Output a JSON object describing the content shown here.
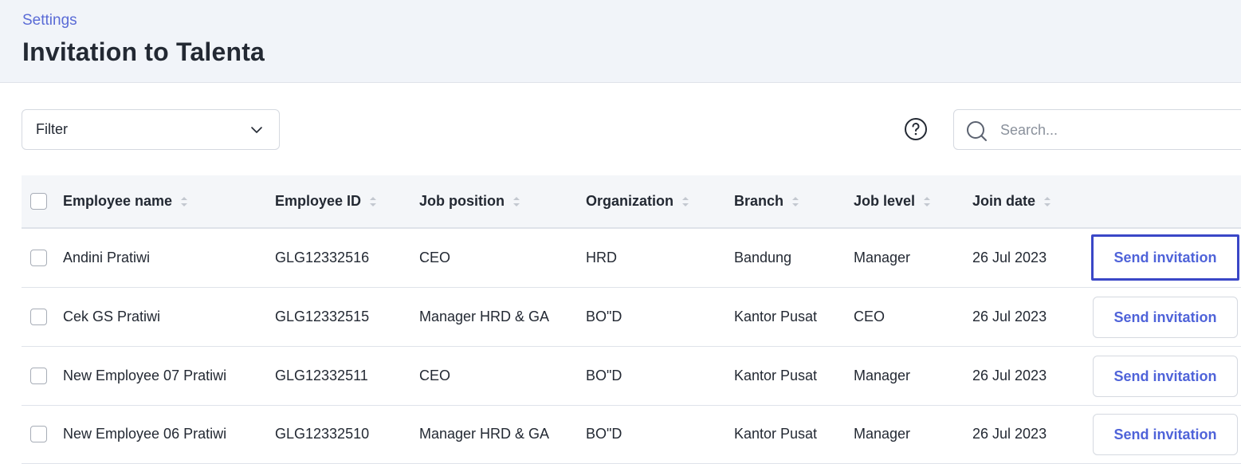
{
  "header": {
    "breadcrumb": "Settings",
    "title": "Invitation to Talenta"
  },
  "toolbar": {
    "filter_label": "Filter",
    "search_placeholder": "Search..."
  },
  "table": {
    "columns": [
      "Employee name",
      "Employee ID",
      "Job position",
      "Organization",
      "Branch",
      "Job level",
      "Join date"
    ],
    "action_label": "Send invitation",
    "rows": [
      {
        "name": "Andini Pratiwi",
        "id": "GLG12332516",
        "position": "CEO",
        "organization": "HRD",
        "branch": "Bandung",
        "level": "Manager",
        "join_date": "26 Jul 2023",
        "action": "Send invitation"
      },
      {
        "name": "Cek GS Pratiwi",
        "id": "GLG12332515",
        "position": "Manager HRD & GA",
        "organization": "BO\"D",
        "branch": "Kantor Pusat",
        "level": "CEO",
        "join_date": "26 Jul 2023",
        "action": "Send invitation"
      },
      {
        "name": "New Employee 07 Pratiwi",
        "id": "GLG12332511",
        "position": "CEO",
        "organization": "BO\"D",
        "branch": "Kantor Pusat",
        "level": "Manager",
        "join_date": "26 Jul 2023",
        "action": "Send invitation"
      },
      {
        "name": "New Employee 06 Pratiwi",
        "id": "GLG12332510",
        "position": "Manager HRD & GA",
        "organization": "BO\"D",
        "branch": "Kantor Pusat",
        "level": "Manager",
        "join_date": "26 Jul 2023",
        "action": "Send invitation"
      }
    ]
  },
  "icons": {
    "filter_chevron": "chevron-down-icon",
    "help": "question-circle-icon",
    "search": "search-icon",
    "sort": "sort-icon"
  },
  "colors": {
    "accent": "#4f63d9",
    "focus_border": "#3a47c7",
    "header_bg": "#f1f4f9"
  }
}
